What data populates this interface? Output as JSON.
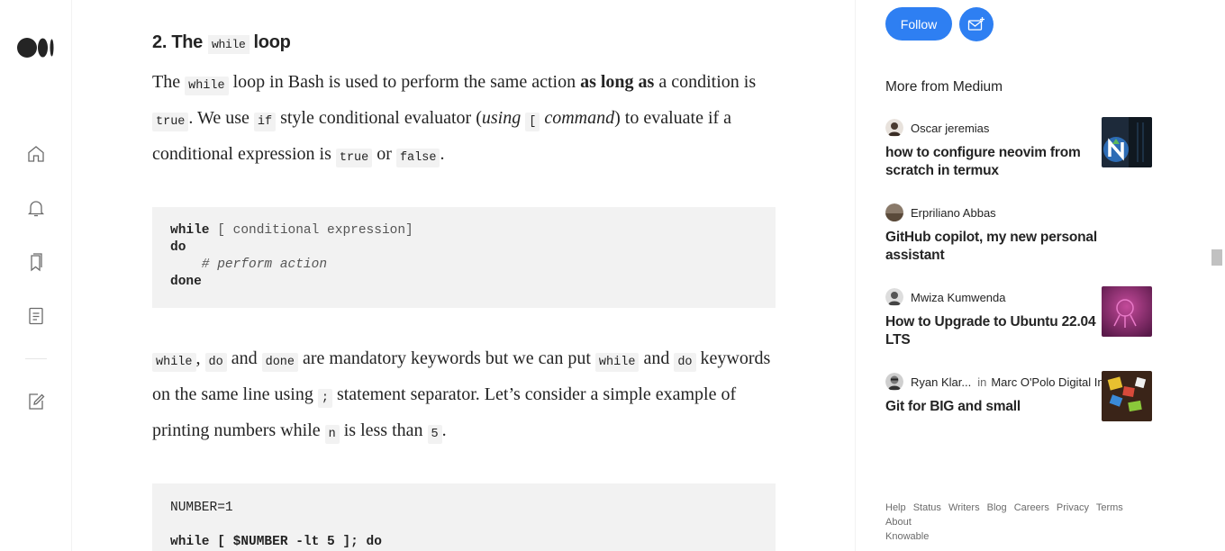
{
  "nav": {
    "items": [
      "home-icon",
      "notifications-icon",
      "bookmarks-icon",
      "stories-icon",
      "write-icon"
    ]
  },
  "article": {
    "heading_prefix": "2. The",
    "heading_code": "while",
    "heading_suffix": "loop",
    "p1": {
      "a": "The",
      "code_while": "while",
      "b": "loop in Bash is used to perform the same action",
      "bold": "as long as",
      "c": "a condition is",
      "code_true": "true",
      "d": ". We use",
      "code_if": "if",
      "e": "style conditional evaluator (",
      "i1": "using",
      "code_bracket": "[",
      "i2": "command",
      "f": ") to evaluate if a conditional expression is",
      "code_true2": "true",
      "g": "or",
      "code_false": "false",
      "h": "."
    },
    "code1": {
      "l1_kw": "while",
      "l1_rest": " [ conditional expression]",
      "l2": "do",
      "l3_comment": "    # perform action",
      "l4": "done"
    },
    "p2": {
      "c_while": "while",
      "sep1": ",",
      "c_do": "do",
      "t1": "and",
      "c_done": "done",
      "t2": "are mandatory keywords but we can put",
      "c_while2": "while",
      "t3": "and",
      "c_do2": "do",
      "t4": "keywords on the same line using",
      "c_semi": ";",
      "t5": "statement separator. Let’s consider a simple example of printing numbers while",
      "c_n": "n",
      "t6": "is less than",
      "c_5": "5",
      "t7": "."
    },
    "code2": {
      "l1": "NUMBER=1",
      "l3": "while [ $NUMBER -lt 5 ]; do"
    }
  },
  "sidebar": {
    "follow_label": "Follow",
    "more_title": "More from Medium",
    "recs": [
      {
        "author": "Oscar jeremias",
        "title": "how to configure neovim from scratch in termux",
        "publication": ""
      },
      {
        "author": "Erpriliano Abbas",
        "title": "GitHub copilot, my new personal assistant",
        "publication": ""
      },
      {
        "author": "Mwiza Kumwenda",
        "title": "How to Upgrade to Ubuntu 22.04 LTS",
        "publication": ""
      },
      {
        "author": "Ryan Klar...",
        "in": "in",
        "publication": "Marc O'Polo Digital In...",
        "title": "Git for BIG and small"
      }
    ],
    "footer_links": [
      "Help",
      "Status",
      "Writers",
      "Blog",
      "Careers",
      "Privacy",
      "Terms",
      "About",
      "Knowable"
    ]
  },
  "colors": {
    "accent": "#2e7ff2",
    "code_bg": "#f2f2f2",
    "text": "#242424",
    "muted": "#6b6b6b"
  }
}
